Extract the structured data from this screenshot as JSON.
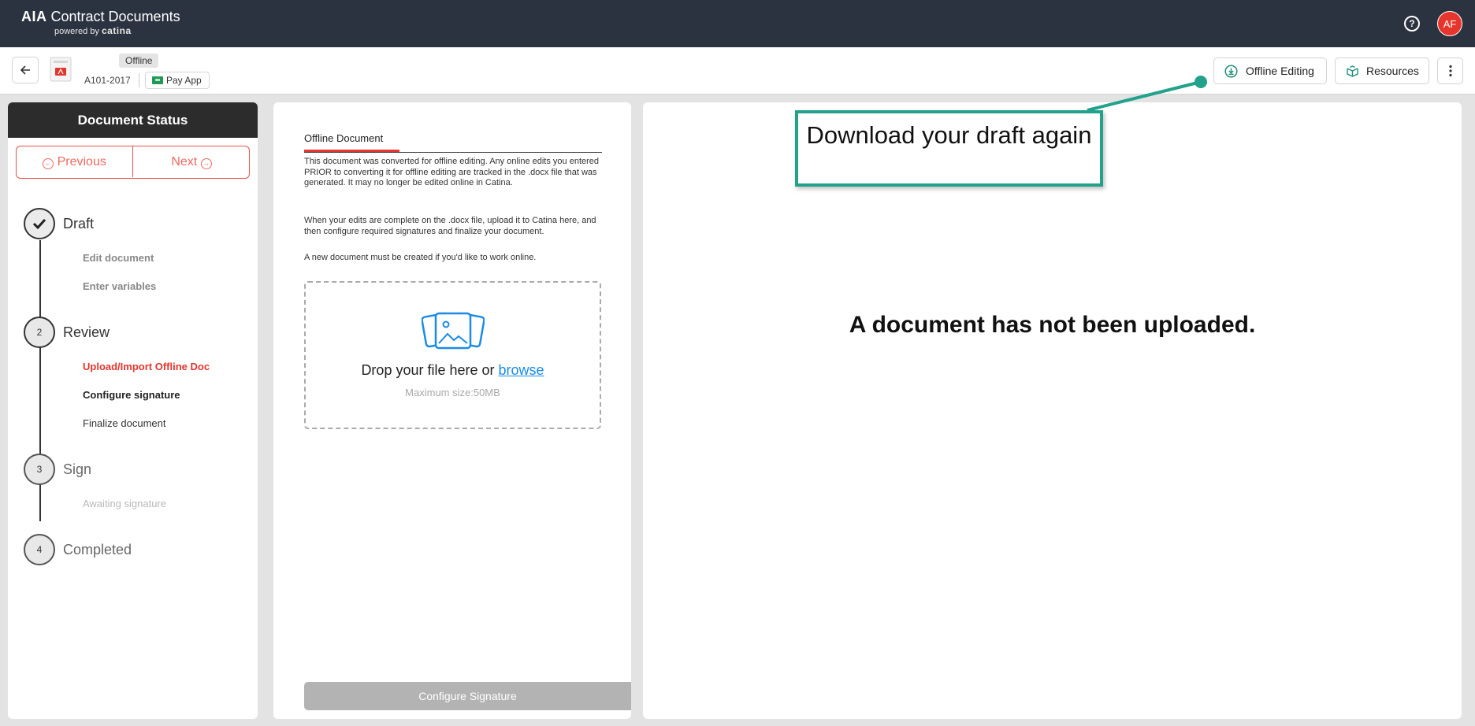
{
  "topbar": {
    "brand_bold": "AIA",
    "brand_rest": "Contract Documents",
    "powered_by": "powered by",
    "powered_brand": "catina",
    "help_glyph": "?",
    "avatar_initials": "AF",
    "avatar_color": "#e5352d"
  },
  "subheader": {
    "status_badge": "Offline",
    "doc_code": "A101-2017",
    "doc_chip": "Pay App",
    "offline_editing_label": "Offline Editing",
    "resources_label": "Resources"
  },
  "status_panel": {
    "title": "Document Status",
    "previous_label": "Previous",
    "next_label": "Next",
    "steps": [
      {
        "number": "",
        "title": "Draft",
        "state": "complete",
        "substeps": [
          "Edit document",
          "Enter variables"
        ]
      },
      {
        "number": "2",
        "title": "Review",
        "state": "active",
        "substeps": [
          "Upload/Import Offline Doc",
          "Configure signature",
          "Finalize document"
        ]
      },
      {
        "number": "3",
        "title": "Sign",
        "state": "pending",
        "substeps": [
          "Awaiting signature"
        ]
      },
      {
        "number": "4",
        "title": "Completed",
        "state": "pending",
        "substeps": []
      }
    ]
  },
  "offline_doc": {
    "tab_title": "Offline Document",
    "paragraph_1": "This document was converted for offline editing. Any online edits you entered PRIOR to converting it for offline editing are tracked in the .docx file that was generated. It may no longer be edited online in Catina.",
    "paragraph_2": "When your edits are complete on the .docx file, upload it to Catina here, and then configure required signatures and finalize your document.",
    "paragraph_3": "A new document must be created if you'd like to work online.",
    "drop_text": "Drop your file here or ",
    "browse_label": "browse",
    "max_size": "Maximum size:50MB",
    "configure_button": "Configure Signature"
  },
  "document_view": {
    "empty_message": "A document has not been uploaded."
  },
  "annotation": {
    "text": "Download your draft again",
    "color": "#22a28b"
  },
  "colors": {
    "topbar_bg": "#2c3340",
    "accent_red": "#e5352d",
    "link_blue": "#1b8be5"
  }
}
